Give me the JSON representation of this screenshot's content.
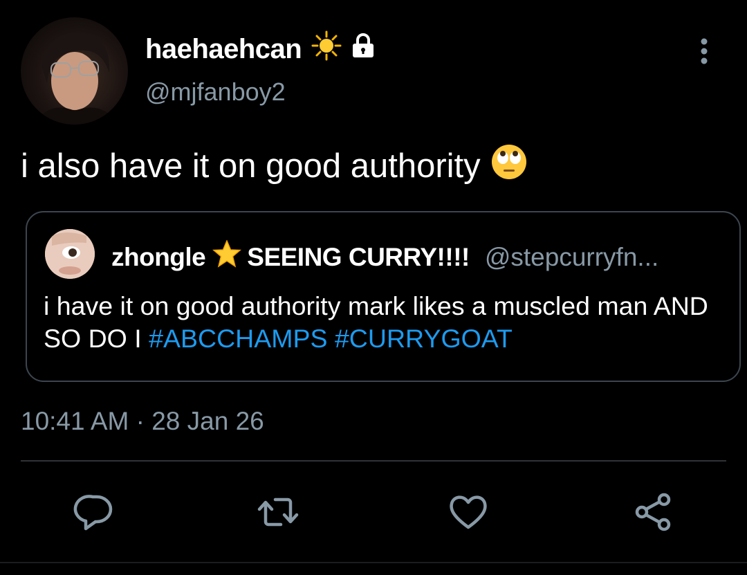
{
  "tweet": {
    "display_name": "haehaehcan",
    "name_icons": [
      "sun-emoji",
      "lock-icon"
    ],
    "handle": "@mjfanboy2",
    "text": "i also have it on good authority",
    "text_emoji": "face-with-rolling-eyes-emoji",
    "timestamp": "10:41 AM · 28 Jan 26"
  },
  "quote": {
    "name": "zhongle",
    "name_suffix": "SEEING CURRY!!!!",
    "handle": "@stepcurryfn...",
    "text_prefix": "i have it on good authority mark likes a muscled man AND SO DO I",
    "hashtags": [
      "#ABCCHAMPS",
      "#CURRYGOAT"
    ]
  },
  "actions": [
    "reply-icon",
    "retweet-icon",
    "like-icon",
    "share-icon"
  ],
  "colors": {
    "background": "#000000",
    "text": "#ffffff",
    "secondary": "#8899a6",
    "hashtag": "#1d9bf0",
    "border": "#3d4650"
  }
}
